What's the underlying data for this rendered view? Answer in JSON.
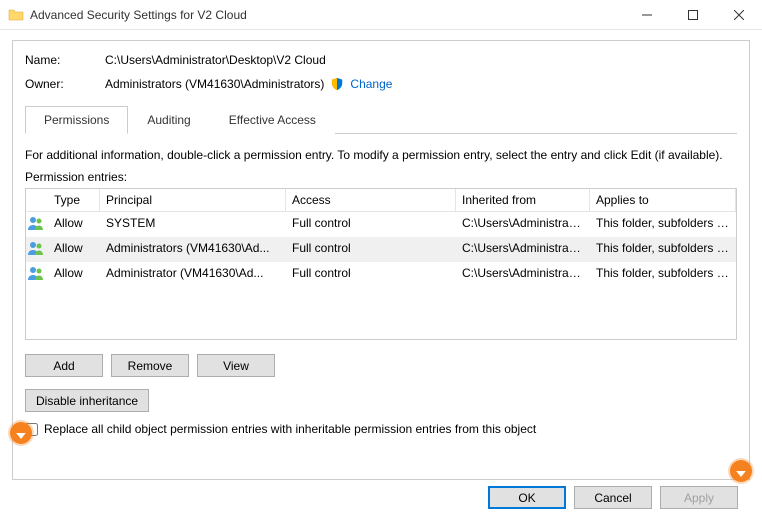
{
  "titlebar": {
    "title": "Advanced Security Settings for V2 Cloud"
  },
  "name_label": "Name:",
  "name_value": "C:\\Users\\Administrator\\Desktop\\V2 Cloud",
  "owner_label": "Owner:",
  "owner_value": "Administrators (VM41630\\Administrators)",
  "change_link": "Change",
  "tabs": {
    "permissions": "Permissions",
    "auditing": "Auditing",
    "effective": "Effective Access"
  },
  "info_text": "For additional information, double-click a permission entry. To modify a permission entry, select the entry and click Edit (if available).",
  "entries_label": "Permission entries:",
  "columns": {
    "type": "Type",
    "principal": "Principal",
    "access": "Access",
    "inherited": "Inherited from",
    "applies": "Applies to"
  },
  "rows": [
    {
      "type": "Allow",
      "principal": "SYSTEM",
      "access": "Full control",
      "inherited": "C:\\Users\\Administrator\\",
      "applies": "This folder, subfolders and files",
      "selected": false
    },
    {
      "type": "Allow",
      "principal": "Administrators (VM41630\\Ad...",
      "access": "Full control",
      "inherited": "C:\\Users\\Administrator\\",
      "applies": "This folder, subfolders and files",
      "selected": true
    },
    {
      "type": "Allow",
      "principal": "Administrator (VM41630\\Ad...",
      "access": "Full control",
      "inherited": "C:\\Users\\Administrator\\",
      "applies": "This folder, subfolders and files",
      "selected": false
    }
  ],
  "buttons": {
    "add": "Add",
    "remove": "Remove",
    "view": "View",
    "disable_inh": "Disable inheritance"
  },
  "checkbox_label": "Replace all child object permission entries with inheritable permission entries from this object",
  "dialog_buttons": {
    "ok": "OK",
    "cancel": "Cancel",
    "apply": "Apply"
  }
}
